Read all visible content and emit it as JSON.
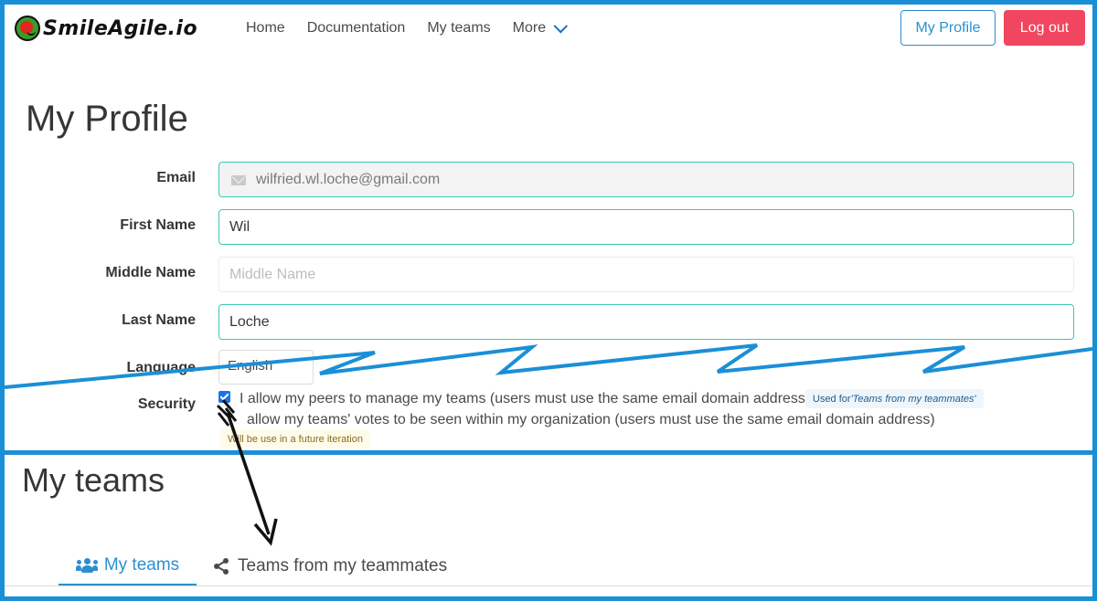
{
  "nav": {
    "logo": "SmileAgile.io",
    "items": [
      "Home",
      "Documentation",
      "My teams",
      "More"
    ],
    "profile_button": "My Profile",
    "logout_button": "Log out"
  },
  "profile": {
    "title": "My Profile",
    "fields": {
      "email": {
        "label": "Email",
        "value": "wilfried.wl.loche@gmail.com"
      },
      "first_name": {
        "label": "First Name",
        "value": "Wil"
      },
      "middle_name": {
        "label": "Middle Name",
        "placeholder": "Middle Name"
      },
      "last_name": {
        "label": "Last Name",
        "value": "Loche"
      },
      "language": {
        "label": "Language",
        "value": "English"
      }
    },
    "security": {
      "label": "Security",
      "option1": "I allow my peers to manage my teams (users must use the same email domain address)",
      "option1_tag_prefix": "Used for ",
      "option1_tag_name": "'Teams from my teammates'",
      "option2": "allow my teams' votes to be seen within my organization (users must use the same email domain address)",
      "option2_tag": "Will be use in a future iteration"
    }
  },
  "teams": {
    "title": "My teams",
    "tabs": [
      "My teams",
      "Teams from my teammates"
    ]
  },
  "colors": {
    "accent": "#2a8fd0",
    "logout": "#f1465f",
    "frame": "#1b8fd6",
    "input_border": "#3cc8b4"
  }
}
